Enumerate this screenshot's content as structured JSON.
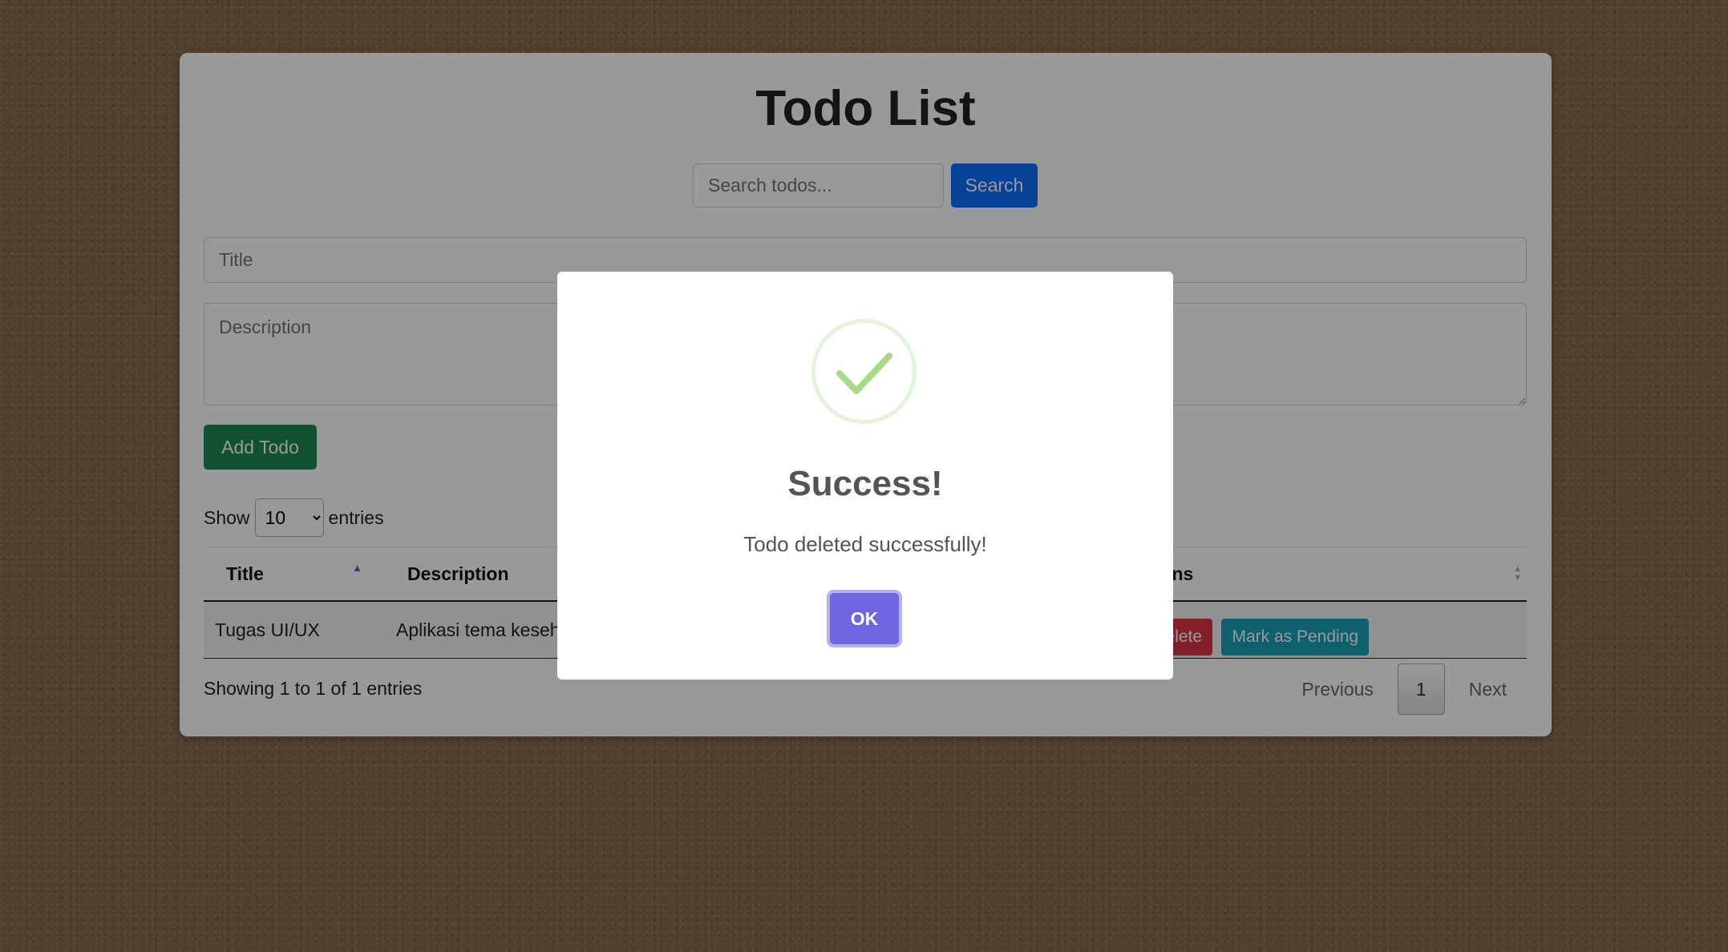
{
  "header": {
    "title": "Todo List"
  },
  "search": {
    "placeholder": "Search todos...",
    "button_label": "Search"
  },
  "form": {
    "title_placeholder": "Title",
    "description_placeholder": "Description",
    "add_button_label": "Add Todo"
  },
  "table_controls": {
    "show_label": "Show",
    "page_size": "10",
    "entries_label": "entries"
  },
  "table": {
    "columns": [
      "Title",
      "Description",
      "Actions"
    ],
    "rows": [
      {
        "title": "Tugas UI/UX",
        "description": "Aplikasi tema kesehatan"
      }
    ],
    "action_labels": {
      "delete": "Delete",
      "mark_pending": "Mark as Pending"
    }
  },
  "footer": {
    "showing_text": "Showing 1 to 1 of 1 entries",
    "prev_label": "Previous",
    "current_page": "1",
    "next_label": "Next"
  },
  "modal": {
    "icon": "success-check-icon",
    "title": "Success!",
    "message": "Todo deleted successfully!",
    "ok_label": "OK"
  },
  "colors": {
    "primary": "#0d6efd",
    "success": "#198754",
    "danger": "#dc3545",
    "info": "#17a2b8",
    "modal_confirm": "#7066e0",
    "check_green": "#a5dc86"
  }
}
